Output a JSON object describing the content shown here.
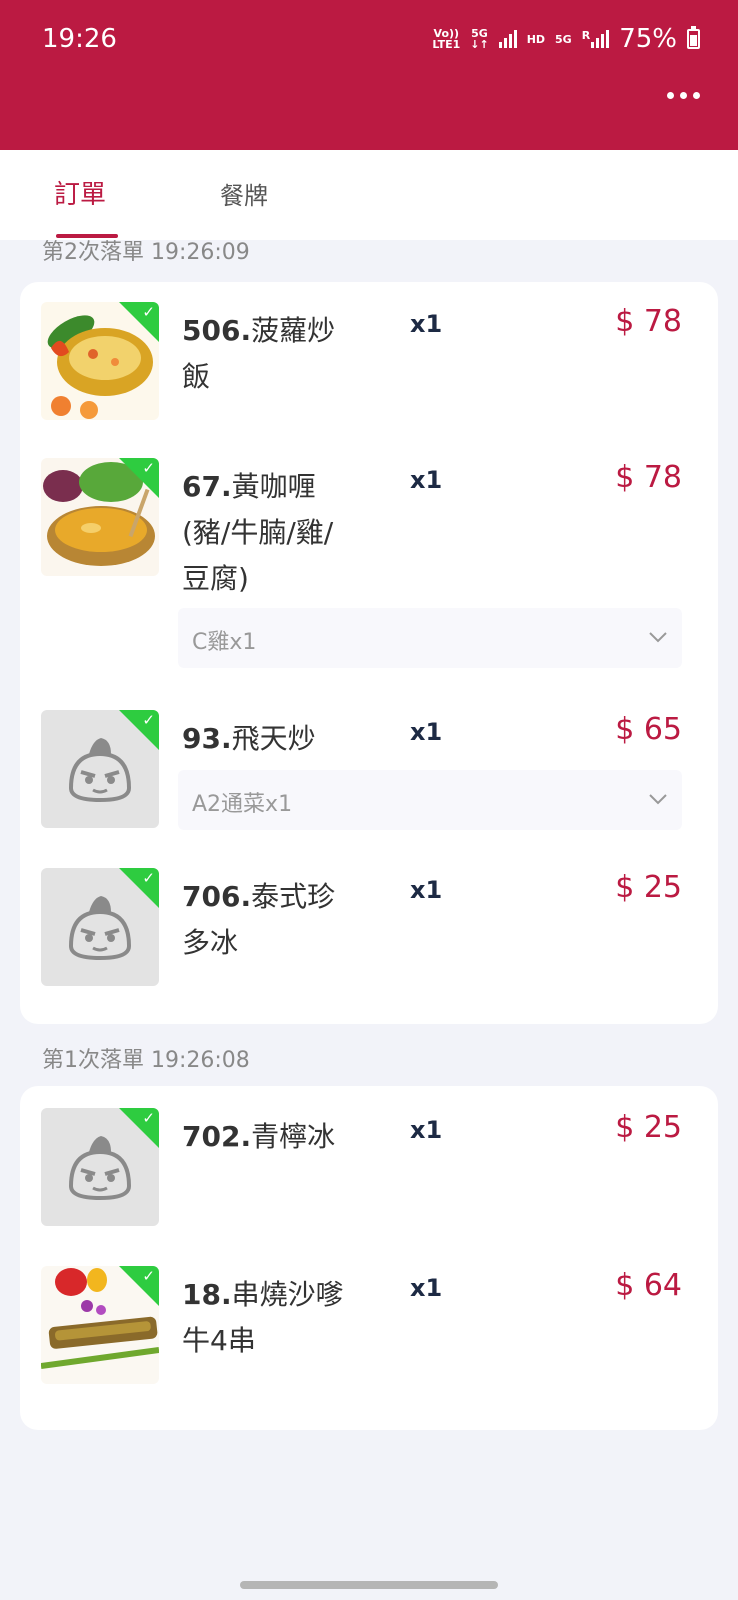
{
  "status": {
    "time": "19:26",
    "volte": "Vo))",
    "lte": "LTE1",
    "net1": "5G",
    "hd": "HD",
    "net2": "5G",
    "roaming": "R",
    "battery": "75%"
  },
  "tabs": [
    {
      "label": "訂單"
    },
    {
      "label": "餐牌"
    }
  ],
  "batches": [
    {
      "label": "第2次落單 19:26:09",
      "items": [
        {
          "num": "506.",
          "name": "菠蘿炒飯",
          "qty": "x1",
          "price": "$ 78"
        },
        {
          "num": "67.",
          "name": "黃咖喱(豬/牛腩/雞/豆腐)",
          "qty": "x1",
          "price": "$ 78",
          "option": "C雞x1"
        },
        {
          "num": "93.",
          "name": "飛天炒",
          "qty": "x1",
          "price": "$ 65",
          "option": "A2通菜x1"
        },
        {
          "num": "706.",
          "name": "泰式珍多冰",
          "qty": "x1",
          "price": "$ 25"
        }
      ]
    },
    {
      "label": "第1次落單 19:26:08",
      "items": [
        {
          "num": "702.",
          "name": "青檸冰",
          "qty": "x1",
          "price": "$ 25"
        },
        {
          "num": "18.",
          "name": "串燒沙嗲 牛4串",
          "qty": "x1",
          "price": "$ 64"
        }
      ]
    }
  ],
  "colors": {
    "brand": "#bb1a42",
    "check": "#2ecc40",
    "qty": "#1d2a44"
  }
}
